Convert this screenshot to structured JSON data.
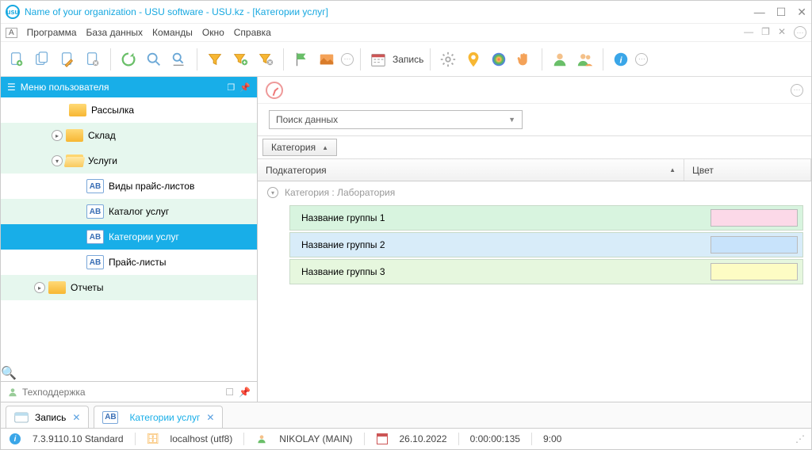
{
  "titlebar": {
    "title": "Name of your organization - USU software - USU.kz - [Категории услуг]"
  },
  "menubar": {
    "items": [
      "Программа",
      "База данных",
      "Команды",
      "Окно",
      "Справка"
    ]
  },
  "toolbar": {
    "record_label": "Запись"
  },
  "left_panel": {
    "header": "Меню пользователя",
    "tree": [
      {
        "label": "Рассылка",
        "type": "folder",
        "stripe": "b",
        "indent": 3,
        "trunc": true
      },
      {
        "label": "Склад",
        "type": "folder",
        "stripe": "a",
        "indent": 2,
        "expander": "▸"
      },
      {
        "label": "Услуги",
        "type": "folder-open",
        "stripe": "a",
        "indent": 2,
        "expander": "▾"
      },
      {
        "label": "Виды прайс-листов",
        "type": "ab",
        "stripe": "b",
        "indent": 4
      },
      {
        "label": "Каталог услуг",
        "type": "ab",
        "stripe": "a",
        "indent": 4
      },
      {
        "label": "Категории услуг",
        "type": "ab",
        "stripe": "selected",
        "indent": 4
      },
      {
        "label": "Прайс-листы",
        "type": "ab",
        "stripe": "b",
        "indent": 4
      },
      {
        "label": "Отчеты",
        "type": "folder",
        "stripe": "a",
        "indent": 1,
        "expander": "▸"
      }
    ],
    "support": "Техподдержка"
  },
  "right_panel": {
    "search_placeholder": "Поиск данных",
    "group_chip": "Категория",
    "columns": {
      "sub": "Подкатегория",
      "color": "Цвет"
    },
    "group_label": "Категория : Лаборатория",
    "rows": [
      {
        "sub": "Название группы 1",
        "cls": "r1"
      },
      {
        "sub": "Название группы 2",
        "cls": "r2"
      },
      {
        "sub": "Название группы 3",
        "cls": "r3"
      }
    ]
  },
  "bottom_tabs": [
    {
      "label": "Запись",
      "icon": "window"
    },
    {
      "label": "Категории услуг",
      "icon": "ab",
      "active": true
    }
  ],
  "statusbar": {
    "version": "7.3.9110.10 Standard",
    "host": "localhost (utf8)",
    "user": "NIKOLAY (MAIN)",
    "date": "26.10.2022",
    "elapsed": "0:00:00:135",
    "time": "9:00"
  }
}
